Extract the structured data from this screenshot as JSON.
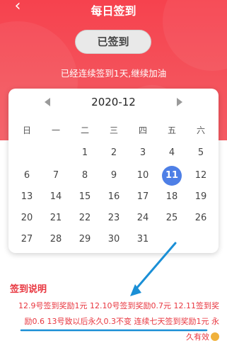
{
  "header": {
    "back_icon": "chevron-left-icon",
    "title": "每日签到",
    "signed_button_label": "已签到",
    "subtitle": "已经连续签到1天,继续加油"
  },
  "calendar": {
    "month": "2020-12",
    "weekdays": [
      "日",
      "一",
      "二",
      "三",
      "四",
      "五",
      "六"
    ],
    "today": "11",
    "days": [
      "1",
      "2",
      "3",
      "4",
      "5",
      "6",
      "7",
      "8",
      "9",
      "10",
      "11",
      "12",
      "13",
      "14",
      "15",
      "16",
      "17",
      "18",
      "19",
      "20",
      "21",
      "22",
      "23",
      "24",
      "25",
      "26",
      "27",
      "28",
      "29",
      "30",
      "31"
    ],
    "today_color": "#4e7fe6"
  },
  "explanation": {
    "title": "签到说明",
    "line1": "12.9号签到奖励1元  12.10号签到奖励0.7元 12.11签到奖",
    "line2": "励0.6  13号致以后永久0.3不变  连续七天签到奖励1元  永",
    "line3": "久有效"
  },
  "colors": {
    "header_red": "#f6424e",
    "accent_red": "#e8363f",
    "annotation_blue": "#1a8fd6"
  }
}
